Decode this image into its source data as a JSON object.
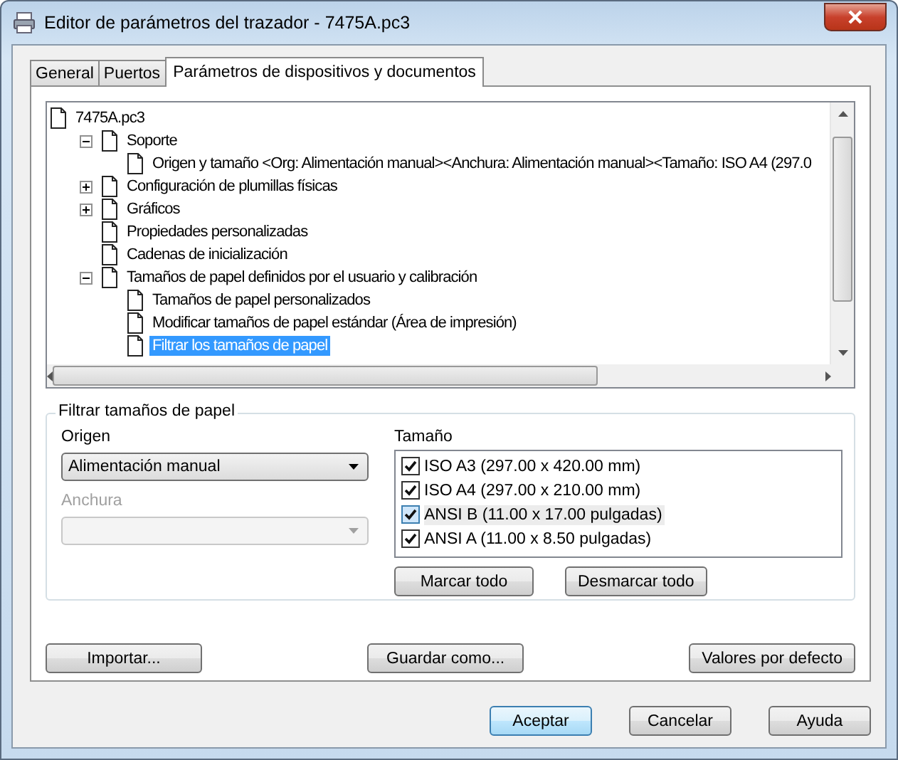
{
  "window": {
    "title": "Editor de parámetros del trazador - 7475A.pc3"
  },
  "tabs": [
    {
      "label": "General",
      "selected": false
    },
    {
      "label": "Puertos",
      "selected": false
    },
    {
      "label": "Parámetros de dispositivos y documentos",
      "selected": true
    }
  ],
  "tree": {
    "items": [
      {
        "label": "7475A.pc3",
        "selected": false,
        "children": [
          {
            "label": "Soporte",
            "expanded": true,
            "selected": false,
            "children": [
              {
                "label": "Origen y tamaño <Org:  Alimentación manual><Anchura: Alimentación manual><Tamaño: ISO A4 (297.0",
                "selected": false
              }
            ]
          },
          {
            "label": "Configuración de plumillas físicas",
            "expanded": false,
            "selected": false
          },
          {
            "label": "Gráficos",
            "expanded": false,
            "selected": false
          },
          {
            "label": "Propiedades personalizadas",
            "selected": false
          },
          {
            "label": "Cadenas de inicialización",
            "selected": false
          },
          {
            "label": "Tamaños de papel definidos por el usuario y calibración",
            "expanded": true,
            "selected": false,
            "children": [
              {
                "label": "Tamaños de papel personalizados",
                "selected": false
              },
              {
                "label": "Modificar tamaños de papel estándar (Área de impresión)",
                "selected": false
              },
              {
                "label": "Filtrar los tamaños de papel",
                "selected": true
              }
            ]
          }
        ]
      }
    ]
  },
  "filter": {
    "title": "Filtrar tamaños de papel",
    "origin": {
      "label": "Origen",
      "value": "Alimentación manual",
      "disabled": false
    },
    "width": {
      "label": "Anchura",
      "disabled": true
    },
    "size": {
      "label": "Tamaño",
      "items": [
        {
          "label": "ISO A3 (297.00 x 420.00 mm)",
          "checked": true,
          "hot": false
        },
        {
          "label": "ISO A4 (297.00 x 210.00 mm)",
          "checked": true,
          "hot": false
        },
        {
          "label": "ANSI B (11.00 x 17.00 pulgadas)",
          "checked": true,
          "hot": true
        },
        {
          "label": "ANSI A (11.00 x 8.50 pulgadas)",
          "checked": true,
          "hot": false
        }
      ],
      "buttons": [
        "Marcar todo",
        "Desmarcar todo"
      ]
    }
  },
  "panel_buttons": [
    "Importar...",
    "Guardar como...",
    "Valores por defecto"
  ],
  "dialog_buttons": [
    {
      "label": "Aceptar",
      "default": true
    },
    {
      "label": "Cancelar",
      "default": false
    },
    {
      "label": "Ayuda",
      "default": false
    }
  ]
}
